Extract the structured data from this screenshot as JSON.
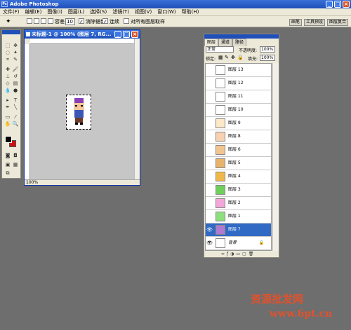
{
  "app": {
    "title": "Adobe Photoshop",
    "logo": "Ps"
  },
  "menu": [
    "文件(F)",
    "编辑(E)",
    "图像(I)",
    "图层(L)",
    "选择(S)",
    "滤镜(T)",
    "视图(V)",
    "窗口(W)",
    "帮助(H)"
  ],
  "options": {
    "tolerance_label": "容差:",
    "tolerance_value": "10",
    "antialias_label": "消除锯齿",
    "contiguous_label": "连续",
    "sample_all_label": "对所有图层取样"
  },
  "wells": [
    "画笔",
    "工具预设",
    "图层复合"
  ],
  "document": {
    "title": "未标题-1 @ 100% (图层 7, RG...",
    "zoom": "100%"
  },
  "layers_panel": {
    "tabs": [
      "图层",
      "通道",
      "路径"
    ],
    "blend_mode": "正常",
    "opacity_label": "不透明度:",
    "opacity_value": "100%",
    "lock_label": "锁定:",
    "fill_label": "填充:",
    "fill_value": "100%",
    "layers": [
      {
        "name": "图层 13",
        "visible": false,
        "selected": false
      },
      {
        "name": "图层 12",
        "visible": false,
        "selected": false
      },
      {
        "name": "图层 11",
        "visible": false,
        "selected": false
      },
      {
        "name": "图层 10",
        "visible": false,
        "selected": false
      },
      {
        "name": "图层 9",
        "visible": false,
        "selected": false
      },
      {
        "name": "图层 8",
        "visible": false,
        "selected": false
      },
      {
        "name": "图层 6",
        "visible": false,
        "selected": false
      },
      {
        "name": "图层 5",
        "visible": false,
        "selected": false
      },
      {
        "name": "图层 4",
        "visible": false,
        "selected": false
      },
      {
        "name": "图层 3",
        "visible": false,
        "selected": false
      },
      {
        "name": "图层 2",
        "visible": false,
        "selected": false
      },
      {
        "name": "图层 1",
        "visible": false,
        "selected": false
      },
      {
        "name": "图层 7",
        "visible": true,
        "selected": true
      },
      {
        "name": "背景",
        "visible": true,
        "selected": false,
        "locked": true
      }
    ]
  },
  "watermark": {
    "line1": "资源批发网",
    "line2": "www.6pt.cn"
  },
  "colors": {
    "foreground": "#000000",
    "background": "#d01010",
    "selection": "#316ac5"
  }
}
